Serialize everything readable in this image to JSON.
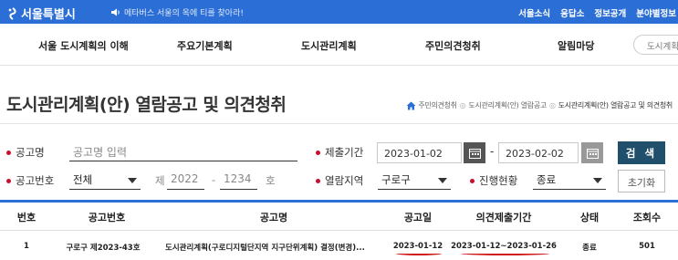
{
  "topbar": {
    "logo_text": "서울특별시",
    "notice_text": "메타버스 서울의 옥에 티를 찾아라!",
    "links": [
      "서울소식",
      "응답소",
      "정보공개",
      "분야별정보"
    ]
  },
  "gnb": {
    "items": [
      "서울 도시계획의 이해",
      "주요기본계획",
      "도시관리계획",
      "주민의견청취",
      "알림마당"
    ],
    "search_placeholder": "도시계획"
  },
  "page": {
    "title": "도시관리계획(안) 열람공고 및 의견청취",
    "breadcrumb": [
      "주민의견청취",
      "도시관리계획(안) 열람공고",
      "도시관리계획(안) 열람공고 및 의견청취"
    ]
  },
  "form": {
    "notice_name_label": "공고명",
    "notice_name_placeholder": "공고명 입력",
    "submit_period_label": "제출기간",
    "start_date": "2023-01-02",
    "end_date": "2023-02-02",
    "search_button": "검 색",
    "notice_no_label": "공고번호",
    "notice_no_select": "전체",
    "notice_no_prefix": "제",
    "notice_year": "2022",
    "notice_dash": "-",
    "notice_number": "1234",
    "notice_suffix": "호",
    "region_label": "열람지역",
    "region_value": "구로구",
    "status_label": "진행현황",
    "status_value": "종료",
    "reset_button": "초기화"
  },
  "table": {
    "columns": [
      "번호",
      "공고번호",
      "공고명",
      "공고일",
      "의견제출기간",
      "상태",
      "조회수"
    ],
    "rows": [
      {
        "no": "1",
        "notice_no": "구로구 제2023-43호",
        "title": "도시관리계획(구로디지털단지역 지구단위계획) 결정(변경)...",
        "date": "2023-01-12",
        "period": "2023-01-12~2023-01-26",
        "status": "종료",
        "views": "501"
      }
    ]
  },
  "colors": {
    "topbar": "#2b6fd6",
    "search_button": "#1f4f6b",
    "bullet": "#c8102e",
    "annotation": "#d11c1c"
  }
}
